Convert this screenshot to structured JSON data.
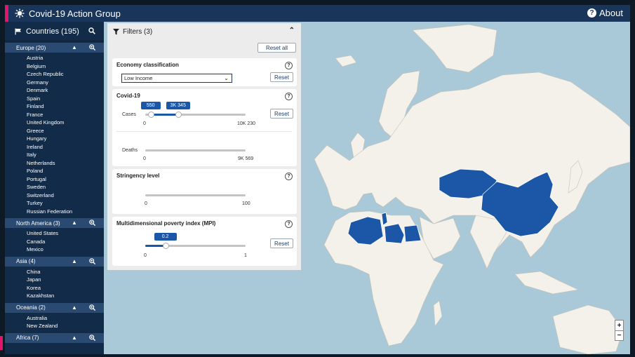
{
  "app": {
    "title": "Covid-19 Action Group",
    "about_label": "About"
  },
  "sidebar": {
    "header": "Countries (195)",
    "regions": [
      {
        "label": "Europe (20)",
        "countries": [
          "Austria",
          "Belgium",
          "Czech Republic",
          "Germany",
          "Denmark",
          "Spain",
          "Finland",
          "France",
          "United Kingdom",
          "Greece",
          "Hungary",
          "Ireland",
          "Italy",
          "Netherlands",
          "Poland",
          "Portugal",
          "Sweden",
          "Switzerland",
          "Turkey",
          "Russian Federation"
        ]
      },
      {
        "label": "North America (3)",
        "countries": [
          "United States",
          "Canada",
          "Mexico"
        ]
      },
      {
        "label": "Asia (4)",
        "countries": [
          "China",
          "Japan",
          "Korea",
          "Kazakhstan"
        ]
      },
      {
        "label": "Oceania (2)",
        "countries": [
          "Australia",
          "New Zealand"
        ]
      },
      {
        "label": "Africa (7)",
        "countries": []
      }
    ]
  },
  "filters": {
    "title": "Filters (3)",
    "reset_all": "Reset all",
    "reset": "Reset",
    "economy": {
      "title": "Economy classification",
      "selected": "Low Income"
    },
    "covid": {
      "title": "Covid-19",
      "cases": {
        "label": "Cases",
        "min_label": "0",
        "max_label": "10K 230",
        "low": "550",
        "high": "3K 345",
        "low_value": 550,
        "high_value": 3345,
        "max_value": 10230
      },
      "deaths": {
        "label": "Deaths",
        "min_label": "0",
        "max_label": "9K 569"
      }
    },
    "stringency": {
      "title": "Stringency level",
      "min_label": "0",
      "max_label": "100"
    },
    "mpi": {
      "title": "Multidimensional poverty index (MPI)",
      "value": "0.2",
      "fraction": 0.2,
      "min_label": "0",
      "max_label": "1"
    }
  },
  "map": {
    "zoom_in": "+",
    "zoom_out": "−",
    "highlight_color": "#1c56a6",
    "land_color": "#f4f1ea",
    "water_color": "#a9c9d8"
  },
  "colors": {
    "topbar": "#19365a",
    "accent": "#e0156b",
    "sidebar": "#112b48",
    "region": "#2a4a72"
  }
}
